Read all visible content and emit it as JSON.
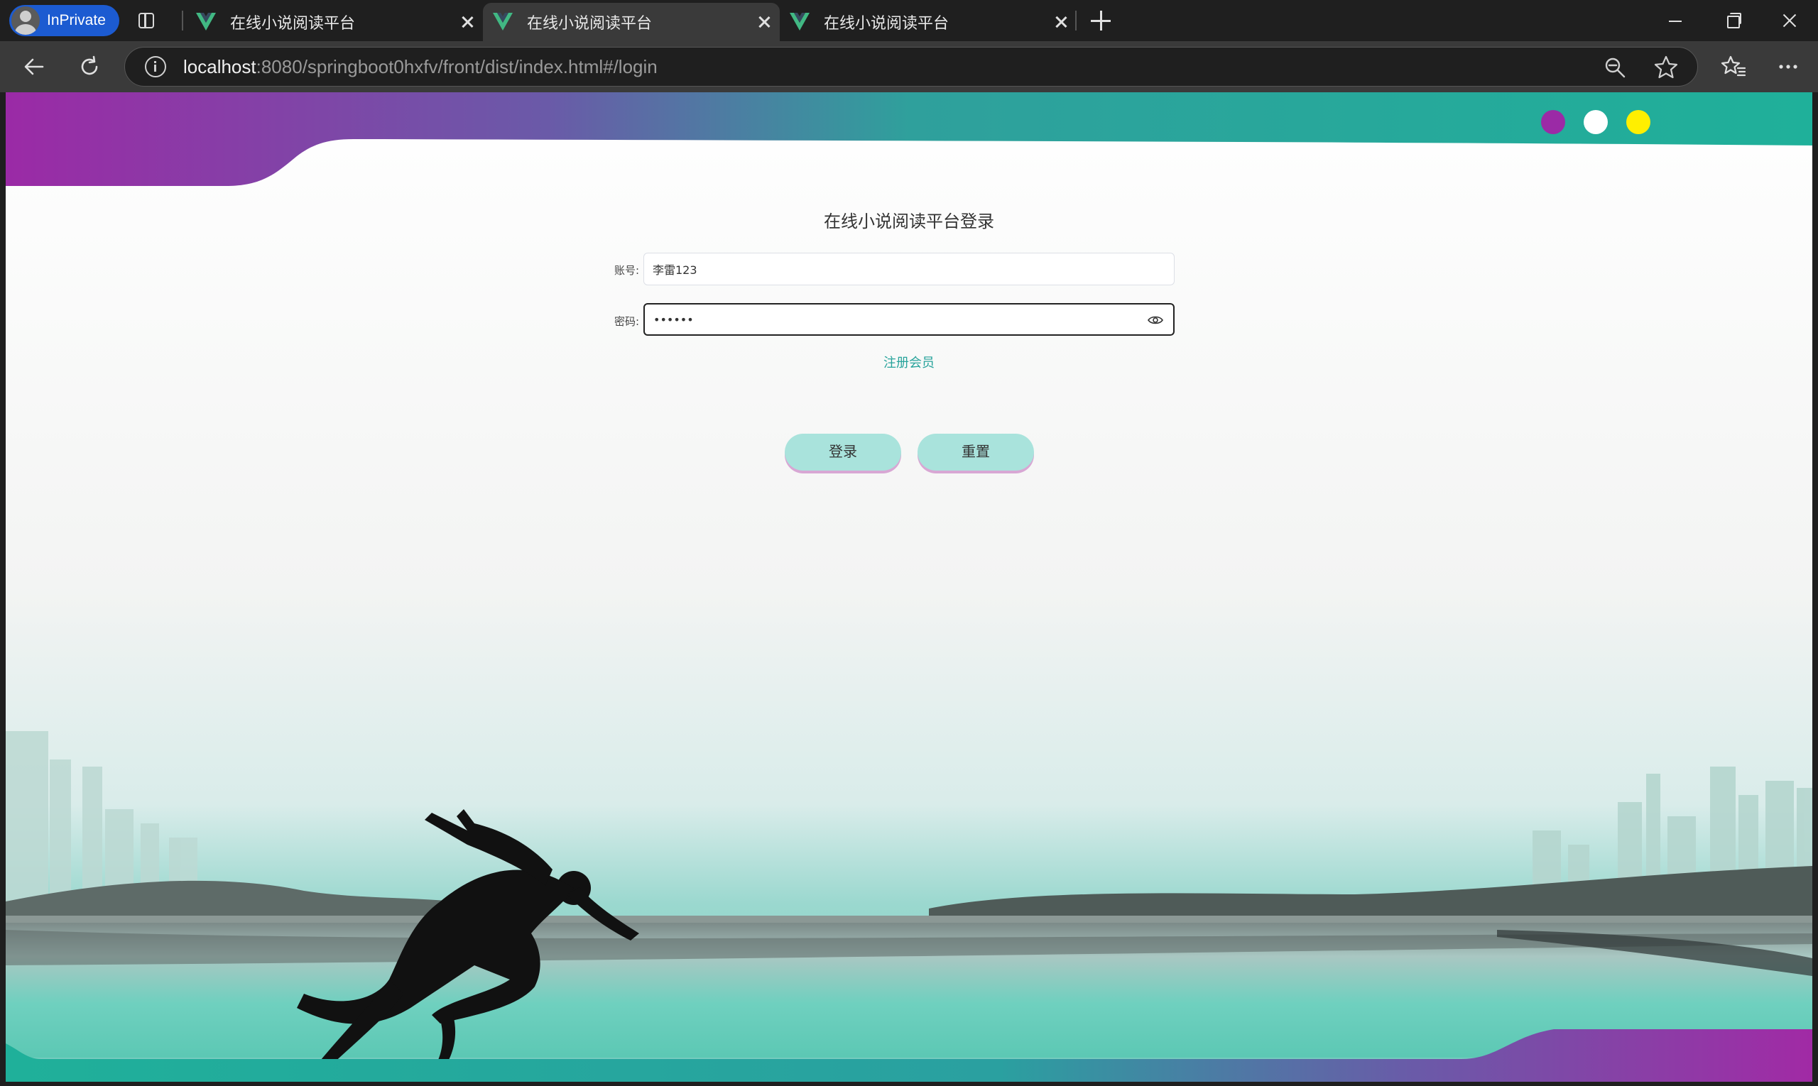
{
  "browser": {
    "inprivate_label": "InPrivate",
    "tabs": [
      {
        "title": "在线小说阅读平台"
      },
      {
        "title": "在线小说阅读平台"
      },
      {
        "title": "在线小说阅读平台"
      }
    ],
    "url_host": "localhost",
    "url_path": ":8080/springboot0hxfv/front/dist/index.html#/login"
  },
  "colors": {
    "purple": "#9b2aa6",
    "teal": "#23a99a",
    "yellow": "#ffef00",
    "button_fill": "#a9e3dc",
    "link": "#27a39b"
  },
  "page": {
    "login_title": "在线小说阅读平台登录",
    "account_label": "账号:",
    "account_value": "李雷123",
    "password_label": "密码:",
    "password_value": "••••••",
    "register_link": "注册会员",
    "login_button": "登录",
    "reset_button": "重置"
  },
  "icons": {
    "vue": "vue-logo-icon",
    "eye": "eye-icon",
    "back": "back-arrow-icon",
    "refresh": "refresh-icon",
    "zoom": "zoom-out-icon",
    "favorite": "star-icon",
    "favorites_bar": "favorites-icon",
    "more": "more-icon"
  }
}
